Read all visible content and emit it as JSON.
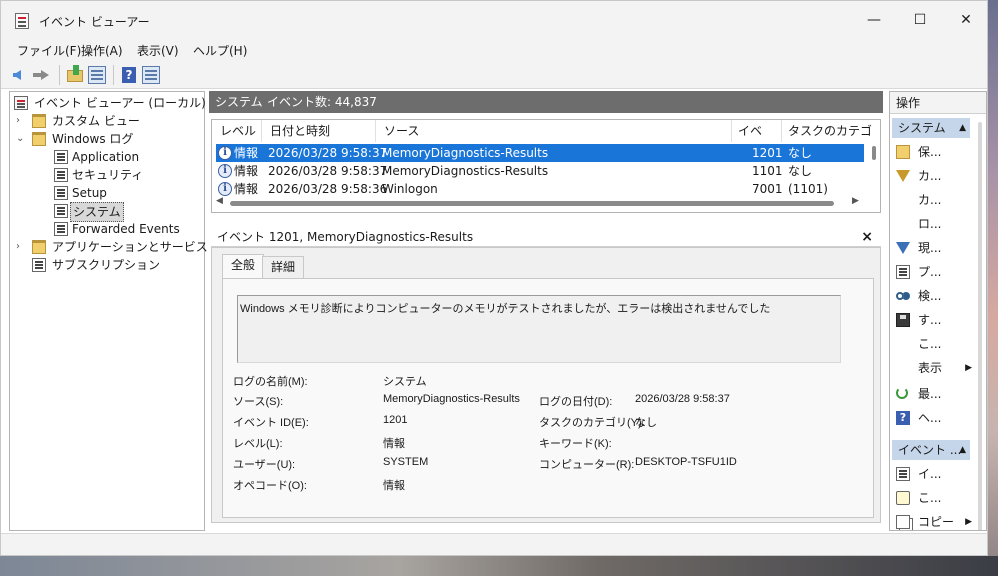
{
  "window": {
    "title": "イベント ビューアー",
    "minimize": "—",
    "maximize": "☐",
    "close": "✕"
  },
  "menu": {
    "file": "ファイル(F)",
    "action": "操作(A)",
    "view": "表示(V)",
    "help": "ヘルプ(H)"
  },
  "tree": {
    "root": "イベント ビューアー (ローカル)",
    "custom_views": "カスタム ビュー",
    "windows_logs": "Windows ログ",
    "application": "Application",
    "security": "セキュリティ",
    "setup": "Setup",
    "system": "システム",
    "forwarded": "Forwarded Events",
    "apps_services": "アプリケーションとサービス ログ",
    "subscriptions": "サブスクリプション",
    "collapsed": "›",
    "expanded": "⌄"
  },
  "center": {
    "log_name": "システム",
    "event_count": "イベント数: 44,837",
    "columns": {
      "level": "レベル",
      "datetime": "日付と時刻",
      "source": "ソース",
      "event_id": "イベン...",
      "task_category": "タスクのカテゴリ"
    },
    "rows": [
      {
        "level": "情報",
        "datetime": "2026/03/28 9:58:37",
        "source": "MemoryDiagnostics-Results",
        "event_id": "1201",
        "task": "なし"
      },
      {
        "level": "情報",
        "datetime": "2026/03/28 9:58:37",
        "source": "MemoryDiagnostics-Results",
        "event_id": "1101",
        "task": "なし"
      },
      {
        "level": "情報",
        "datetime": "2026/03/28 9:58:36",
        "source": "Winlogon",
        "event_id": "7001",
        "task": "(1101)"
      }
    ]
  },
  "detail": {
    "header": "イベント 1201, MemoryDiagnostics-Results",
    "close": "×",
    "tab_general": "全般",
    "tab_details": "詳細",
    "description": "Windows メモリ診断によりコンピューターのメモリがテストされましたが、エラーは検出されませんでした",
    "labels": {
      "log_name": "ログの名前(M):",
      "source": "ソース(S):",
      "event_id": "イベント ID(E):",
      "level": "レベル(L):",
      "user": "ユーザー(U):",
      "opcode": "オペコード(O):",
      "logged": "ログの日付(D):",
      "task_category": "タスクのカテゴリ(Y):",
      "keywords": "キーワード(K):",
      "computer": "コンピューター(R):"
    },
    "values": {
      "log_name": "システム",
      "source": "MemoryDiagnostics-Results",
      "event_id": "1201",
      "level": "情報",
      "user": "SYSTEM",
      "opcode": "情報",
      "logged": "2026/03/28 9:58:37",
      "task_category": "なし",
      "keywords": "",
      "computer": "DESKTOP-TSFU1ID"
    }
  },
  "actions": {
    "title": "操作",
    "section_system": "システム",
    "section_event": "イベント ...",
    "collapse": "▲",
    "submenu": "▶",
    "items": [
      "保...",
      "カ...",
      "カ...",
      "ロ...",
      "現...",
      "プ...",
      "検...",
      "す...",
      "こ...",
      "表示",
      "最...",
      "ヘ..."
    ],
    "event_items": [
      "イ...",
      "こ...",
      "コピー"
    ]
  },
  "colors": {
    "selection": "#1a75d8",
    "header_bar": "#6d6d6d",
    "actions_section": "#c6d6ea"
  }
}
